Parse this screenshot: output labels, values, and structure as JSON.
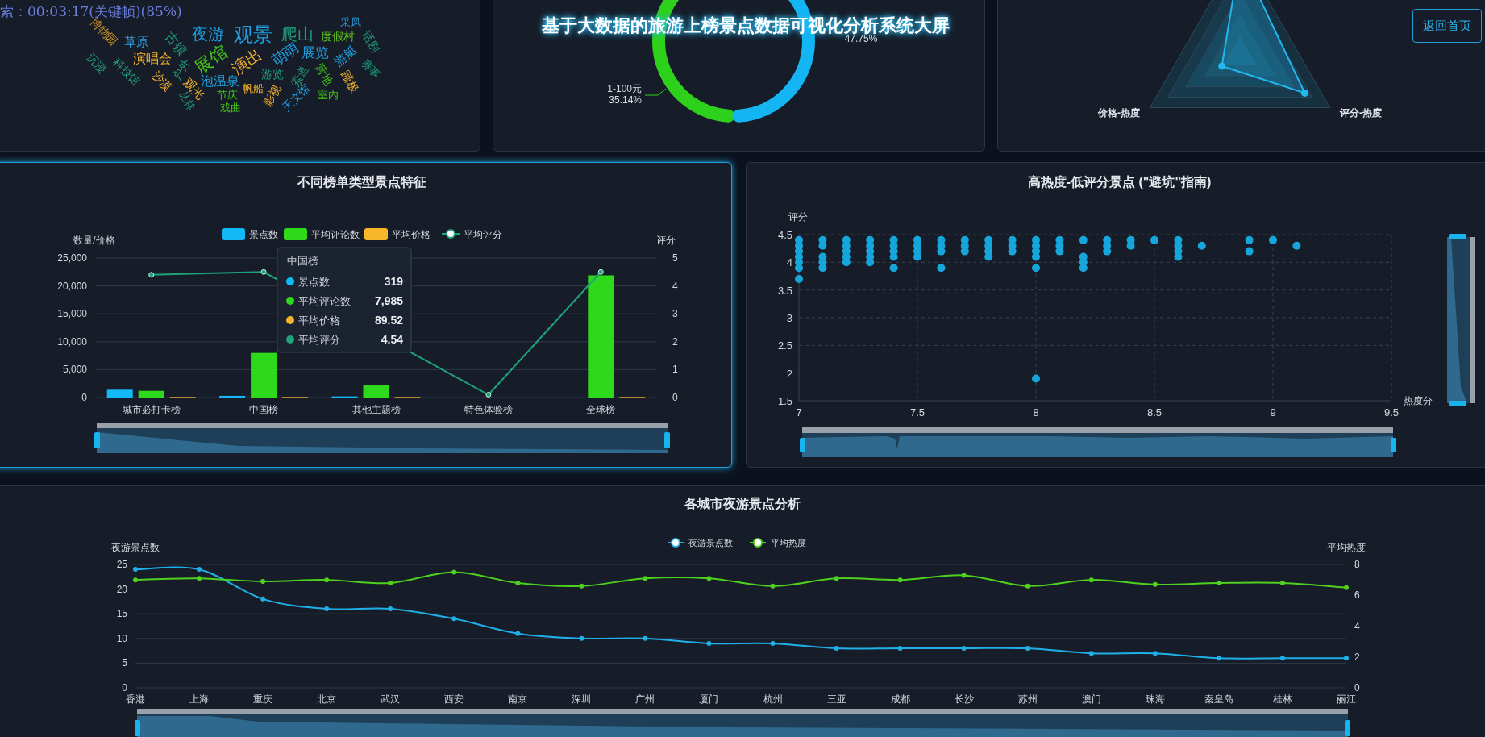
{
  "video_seek_tooltip": "索：00:03:17(关键帧)(85%)",
  "page_title": "基于大数据的旅游上榜景点数据可视化分析系统大屏",
  "home_button": "返回首页",
  "word_cloud": [
    {
      "text": "博物园",
      "color": "#c8922a"
    },
    {
      "text": "夜游",
      "color": "#1e9fe0"
    },
    {
      "text": "观景",
      "color": "#1e9fe0"
    },
    {
      "text": "爬山",
      "color": "#1f9c7a"
    },
    {
      "text": "采风",
      "color": "#2a8fd0"
    },
    {
      "text": "草原",
      "color": "#2a9fe0"
    },
    {
      "text": "古镇",
      "color": "#1f9c7a"
    },
    {
      "text": "度假村",
      "color": "#5cc11e"
    },
    {
      "text": "话剧",
      "color": "#1f9c7a"
    },
    {
      "text": "演唱会",
      "color": "#f5b130"
    },
    {
      "text": "展馆",
      "color": "#43c21c"
    },
    {
      "text": "演出",
      "color": "#f5b130"
    },
    {
      "text": "萌萌",
      "color": "#1e9fe0"
    },
    {
      "text": "展览",
      "color": "#1e9fe0"
    },
    {
      "text": "游艇",
      "color": "#1e9fe0"
    },
    {
      "text": "沉浸",
      "color": "#1f9c7a"
    },
    {
      "text": "科技馆",
      "color": "#1f9c7a"
    },
    {
      "text": "户外",
      "color": "#1f9c7a"
    },
    {
      "text": "沙漠",
      "color": "#f5b130"
    },
    {
      "text": "观光",
      "color": "#f5b130"
    },
    {
      "text": "泡温泉",
      "color": "#1e9fe0"
    },
    {
      "text": "游览",
      "color": "#1f9c7a"
    },
    {
      "text": "索道",
      "color": "#1f9c7a"
    },
    {
      "text": "营地",
      "color": "#43c21c"
    },
    {
      "text": "赛事",
      "color": "#1f9c7a"
    },
    {
      "text": "蹦极",
      "color": "#f5b130"
    },
    {
      "text": "丛林",
      "color": "#1f9c7a"
    },
    {
      "text": "节庆",
      "color": "#43c21c"
    },
    {
      "text": "帆船",
      "color": "#f5b130"
    },
    {
      "text": "影视",
      "color": "#f5b130"
    },
    {
      "text": "天文馆",
      "color": "#1e9fe0"
    },
    {
      "text": "室内",
      "color": "#43c21c"
    },
    {
      "text": "戏曲",
      "color": "#43c21c"
    }
  ],
  "price_donut": [
    {
      "label": "1-100元",
      "percent": "35.14%",
      "color": "#2dd11c"
    },
    {
      "percent": "47.75%",
      "color": "#13b5f2"
    }
  ],
  "radar_labels": [
    "价格-热度",
    "评分-热度"
  ],
  "list_type_panel": {
    "title": "不同榜单类型景点特征",
    "chart_data": {
      "type": "bar",
      "legend": "top",
      "grid": true,
      "categories": [
        "城市必打卡榜",
        "中国榜",
        "其他主题榜",
        "特色体验榜",
        "全球榜"
      ],
      "ylabel": "数量/价格",
      "y2label": "评分",
      "ylim": [
        0,
        25000
      ],
      "y2lim": [
        0,
        5
      ],
      "yticks": [
        {
          "value": 0,
          "label": "0"
        },
        {
          "value": 5000,
          "label": "5,000"
        },
        {
          "value": 10000,
          "label": "10,000"
        },
        {
          "value": 15000,
          "label": "15,000"
        },
        {
          "value": 20000,
          "label": "20,000"
        },
        {
          "value": 25000,
          "label": "25,000"
        }
      ],
      "y2ticks": [
        0,
        1,
        2,
        3,
        4,
        5
      ],
      "series": [
        {
          "name": "景点数",
          "color": "#13b8f7",
          "values": [
            1400,
            300,
            200,
            null,
            null
          ]
        },
        {
          "name": "平均评论数",
          "color": "#2ed81a",
          "values": [
            1200,
            8000,
            2300,
            0,
            21900
          ]
        },
        {
          "name": "平均价格",
          "color": "#f7b52a",
          "values": [
            100,
            100,
            100,
            0,
            100
          ]
        },
        {
          "name": "平均评分",
          "color": "#1fa37b",
          "type": "line",
          "axis": "y2",
          "marker": true,
          "values": [
            4.4,
            4.5,
            null,
            0.1,
            4.5
          ]
        }
      ]
    },
    "tooltip": {
      "title": "中国榜",
      "rows": [
        {
          "label": "景点数",
          "value": "319",
          "color": "#13b8f7"
        },
        {
          "label": "平均评论数",
          "value": "7,985",
          "color": "#2ed81a"
        },
        {
          "label": "平均价格",
          "value": "89.52",
          "color": "#f7b52a"
        },
        {
          "label": "平均评分",
          "value": "4.54",
          "color": "#1fa37b"
        }
      ]
    }
  },
  "avoid_panel": {
    "title": "高热度-低评分景点 (\"避坑\"指南)",
    "chart_data": {
      "type": "scatter",
      "grid": true,
      "xlabel": "热度分",
      "ylabel": "评分",
      "xlim": [
        7,
        9.5
      ],
      "ylim": [
        1.5,
        4.5
      ],
      "xticks": [
        7,
        7.5,
        8,
        8.5,
        9,
        9.5
      ],
      "yticks": [
        1.5,
        2,
        2.5,
        3,
        3.5,
        4,
        4.5
      ],
      "x": [
        7,
        7,
        7,
        7,
        7,
        7,
        7,
        7.1,
        7.1,
        7.1,
        7.1,
        7.1,
        7.2,
        7.2,
        7.2,
        7.2,
        7.2,
        7.3,
        7.3,
        7.3,
        7.3,
        7.3,
        7.4,
        7.4,
        7.4,
        7.4,
        7.4,
        7.5,
        7.5,
        7.5,
        7.5,
        7.6,
        7.6,
        7.6,
        7.6,
        7.7,
        7.7,
        7.7,
        7.8,
        7.8,
        7.8,
        7.8,
        7.9,
        7.9,
        7.9,
        8,
        8,
        8,
        8,
        8,
        8,
        8.1,
        8.1,
        8.1,
        8.2,
        8.2,
        8.2,
        8.2,
        8.3,
        8.3,
        8.3,
        8.4,
        8.4,
        8.5,
        8.6,
        8.6,
        8.6,
        8.6,
        8.7,
        8.9,
        8.9,
        9,
        9.1
      ],
      "series": [
        {
          "color": "#16a6dc",
          "values": [
            4.4,
            4.3,
            4.2,
            4.1,
            4,
            3.9,
            3.7,
            4.4,
            4.3,
            4.1,
            4,
            3.9,
            4.4,
            4.3,
            4.2,
            4.1,
            4,
            4.4,
            4.3,
            4.2,
            4.1,
            4,
            4.4,
            4.3,
            4.2,
            4.1,
            3.9,
            4.4,
            4.3,
            4.2,
            4.1,
            4.4,
            4.3,
            4.2,
            3.9,
            4.4,
            4.3,
            4.2,
            4.4,
            4.3,
            4.2,
            4.1,
            4.4,
            4.3,
            4.2,
            4.4,
            4.3,
            4.2,
            4.1,
            3.9,
            1.9,
            4.4,
            4.3,
            4.2,
            4.4,
            4.1,
            4,
            3.9,
            4.4,
            4.3,
            4.2,
            4.4,
            4.3,
            4.4,
            4.4,
            4.3,
            4.2,
            4.1,
            4.3,
            4.4,
            4.2,
            4.4,
            4.3
          ]
        }
      ]
    }
  },
  "night_panel": {
    "title": "各城市夜游景点分析",
    "chart_data": {
      "type": "line",
      "legend": "top",
      "grid": true,
      "categories": [
        "香港",
        "上海",
        "重庆",
        "北京",
        "武汉",
        "西安",
        "南京",
        "深圳",
        "广州",
        "厦门",
        "杭州",
        "三亚",
        "成都",
        "长沙",
        "苏州",
        "澳门",
        "珠海",
        "秦皇岛",
        "桂林",
        "丽江"
      ],
      "ylabel": "夜游景点数",
      "y2label": "平均热度",
      "ylim": [
        0,
        25
      ],
      "y2lim": [
        0,
        8
      ],
      "yticks": [
        0,
        5,
        10,
        15,
        20,
        25
      ],
      "y2ticks": [
        0,
        2,
        4,
        6,
        8
      ],
      "series": [
        {
          "name": "夜游景点数",
          "color": "#1fb0ea",
          "marker": true,
          "values": [
            24,
            24,
            18,
            16,
            16,
            14,
            11,
            10,
            10,
            9,
            9,
            8,
            8,
            8,
            8,
            7,
            7,
            6,
            6,
            6
          ]
        },
        {
          "name": "平均热度",
          "color": "#4ed21f",
          "axis": "y2",
          "marker": true,
          "values": [
            7,
            7.1,
            6.9,
            7,
            6.8,
            7.5,
            6.8,
            6.6,
            7.1,
            7.1,
            6.6,
            7.1,
            7,
            7.3,
            6.6,
            7,
            6.7,
            6.8,
            6.8,
            6.5
          ]
        }
      ]
    }
  }
}
